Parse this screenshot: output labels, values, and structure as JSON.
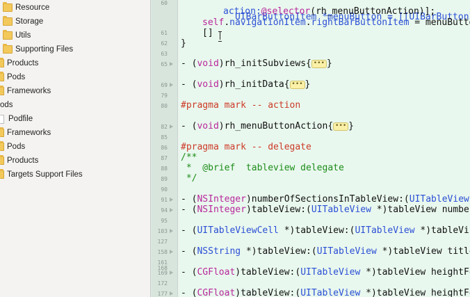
{
  "navigator": {
    "items": [
      {
        "label": "Resource",
        "icon": "folder"
      },
      {
        "label": "Storage",
        "icon": "folder"
      },
      {
        "label": "Utils",
        "icon": "folder"
      },
      {
        "label": "Supporting Files",
        "icon": "folder"
      },
      {
        "label": "Products",
        "icon": "folder"
      },
      {
        "label": "Pods",
        "icon": "folder"
      },
      {
        "label": "Frameworks",
        "icon": "folder"
      },
      {
        "label": "ods",
        "icon": "none"
      },
      {
        "label": "Podfile",
        "icon": "file"
      },
      {
        "label": "Frameworks",
        "icon": "folder"
      },
      {
        "label": "Pods",
        "icon": "folder"
      },
      {
        "label": "Products",
        "icon": "folder"
      },
      {
        "label": "Targets Support Files",
        "icon": "folder"
      }
    ]
  },
  "gutter": {
    "line_numbers": [
      "60",
      "61",
      "62",
      "63",
      "65",
      "69",
      "79",
      "80",
      "82",
      "85",
      "86",
      "87",
      "88",
      "89",
      "90",
      "91",
      "94",
      "95",
      "103",
      "127",
      "158",
      "161",
      "168",
      "169",
      "172",
      "177"
    ]
  },
  "editor": {
    "lines": {
      "l60_a": "UIBarButtonItem *menuButton = [[UIBarButtonItem a",
      "l60_b_kw": "action:",
      "l60_b_sel": "@selector",
      "l60_b_rest": "(rh_menuButtonAction)];",
      "l61_self": "self",
      "l61_dot1": ".",
      "l61_nav": "navigationItem",
      "l61_dot2": ".",
      "l61_right": "rightBarButtonItem",
      "l61_rest": " = menuButto",
      "l62": "[]",
      "l63": "}",
      "l65_dash": "- (",
      "l65_void": "void",
      "l65_name": ")rh_initSubviews{",
      "l65_close": "}",
      "l69_dash": "- (",
      "l69_void": "void",
      "l69_name": ")rh_initData{",
      "l69_close": "}",
      "l80_pragma": "#pragma mark -- action",
      "l82_dash": "- (",
      "l82_void": "void",
      "l82_name": ")rh_menuButtonAction{",
      "l82_close": "}",
      "l86_pragma": "#pragma mark -- delegate",
      "l87": "/**",
      "l88": " *  @brief  tableview delegate",
      "l89": " */",
      "l91_dash": "- (",
      "l91_type": "NSInteger",
      "l91_rest": ")numberOfSectionsInTableView:(",
      "l91_type2": "UITableView",
      "l94_dash": "- (",
      "l94_type": "NSInteger",
      "l94_rest": ")tableView:(",
      "l94_type2": "UITableView",
      "l94_rest2": " *)tableView numbe",
      "l103_dash": "- (",
      "l103_type": "UITableViewCell",
      "l103_rest": " *)tableView:(",
      "l103_type2": "UITableView",
      "l103_rest2": " *)tableVi",
      "l158_dash": "- (",
      "l158_type": "NSString",
      "l158_rest": " *)tableView:(",
      "l158_type2": "UITableView",
      "l158_rest2": " *)tableView title",
      "l169_dash": "- (",
      "l169_type": "CGFloat",
      "l169_rest": ")tableView:(",
      "l169_type2": "UITableView",
      "l169_rest2": " *)tableView heightFo",
      "l177_dash": "- (",
      "l177_type": "CGFloat",
      "l177_rest": ")tableView:(",
      "l177_type2": "UITableView",
      "l177_rest2": " *)tableView heightFo"
    },
    "fold_placeholder": "•••"
  },
  "colors": {
    "editor_bg": "#e9f8ee",
    "keyword": "#b8279c",
    "type": "#2b4fd6",
    "pragma": "#cc3a27",
    "comment": "#1c8c1a"
  }
}
